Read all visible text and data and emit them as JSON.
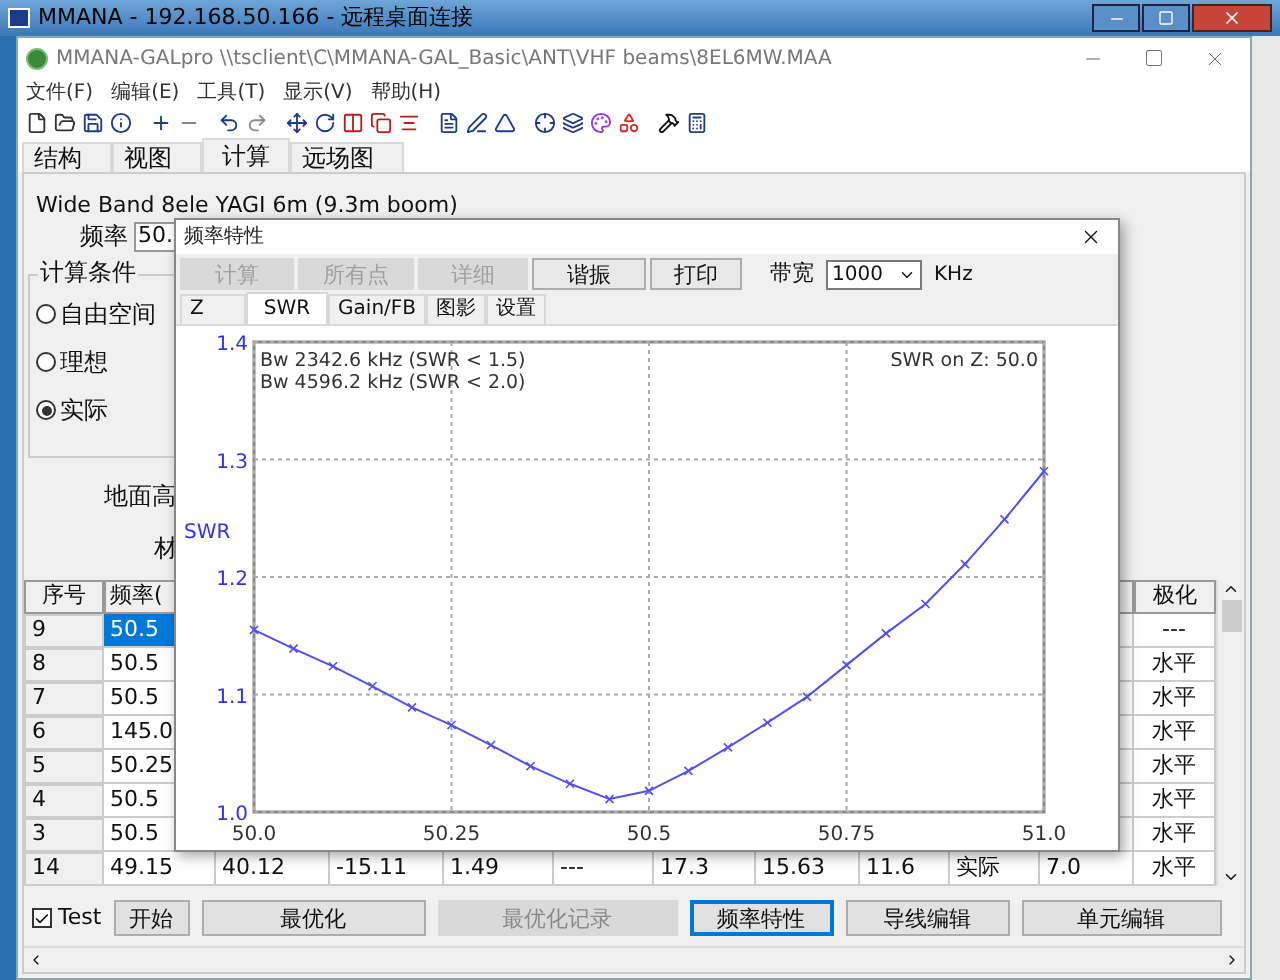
{
  "remote_window": {
    "title": "MMANA - 192.168.50.166 - 远程桌面连接"
  },
  "window": {
    "title": "MMANA-GALpro \\\\tsclient\\C\\MMANA-GAL_Basic\\ANT\\VHF beams\\8EL6MW.MAA"
  },
  "menu": [
    "文件(F)",
    "编辑(E)",
    "工具(T)",
    "显示(V)",
    "帮助(H)"
  ],
  "tabs": [
    {
      "label": "结构",
      "selected": false
    },
    {
      "label": "视图",
      "selected": false
    },
    {
      "label": "计算",
      "selected": true
    },
    {
      "label": "远场图",
      "selected": false
    }
  ],
  "antenna_name": "Wide Band 8ele YAGI 6m (9.3m boom)",
  "frequency": {
    "label": "频率",
    "value": "50."
  },
  "conditions": {
    "title": "计算条件",
    "options": [
      {
        "label": "自由空间",
        "selected": false
      },
      {
        "label": "理想",
        "selected": false
      },
      {
        "label": "实际",
        "selected": true
      }
    ]
  },
  "ground_height_label": "地面高",
  "material_label": "材",
  "table": {
    "columns": [
      "序号",
      "频率(",
      null,
      null,
      null,
      null,
      null,
      null,
      null,
      null,
      null,
      "极化"
    ],
    "rows": [
      {
        "selected": true,
        "cells": [
          "9",
          "50.5",
          null,
          null,
          null,
          null,
          null,
          null,
          null,
          null,
          null,
          "---"
        ]
      },
      {
        "selected": false,
        "cells": [
          "8",
          "50.5",
          null,
          null,
          null,
          null,
          null,
          null,
          null,
          null,
          null,
          "水平"
        ]
      },
      {
        "selected": false,
        "cells": [
          "7",
          "50.5",
          null,
          null,
          null,
          null,
          null,
          null,
          null,
          null,
          null,
          "水平"
        ]
      },
      {
        "selected": false,
        "cells": [
          "6",
          "145.0",
          null,
          null,
          null,
          null,
          null,
          null,
          null,
          null,
          null,
          "水平"
        ]
      },
      {
        "selected": false,
        "cells": [
          "5",
          "50.25",
          null,
          null,
          null,
          null,
          null,
          null,
          null,
          null,
          null,
          "水平"
        ]
      },
      {
        "selected": false,
        "cells": [
          "4",
          "50.5",
          null,
          null,
          null,
          null,
          null,
          null,
          null,
          null,
          null,
          "水平"
        ]
      },
      {
        "selected": false,
        "cells": [
          "3",
          "50.5",
          null,
          null,
          null,
          null,
          null,
          null,
          null,
          null,
          null,
          "水平"
        ]
      },
      {
        "selected": false,
        "cells": [
          "14",
          "49.15",
          "40.12",
          "-15.11",
          "1.49",
          "---",
          "17.3",
          "15.63",
          "11.6",
          "实际",
          "7.0",
          "水平"
        ]
      }
    ]
  },
  "test_checkbox": {
    "label": "Test",
    "checked": true
  },
  "buttons": [
    {
      "label": "开始",
      "disabled": false,
      "focused": false
    },
    {
      "label": "最优化",
      "disabled": false,
      "focused": false
    },
    {
      "label": "最优化记录",
      "disabled": true,
      "focused": false
    },
    {
      "label": "频率特性",
      "disabled": false,
      "focused": true
    },
    {
      "label": "导线编辑",
      "disabled": false,
      "focused": false
    },
    {
      "label": "单元编辑",
      "disabled": false,
      "focused": false
    }
  ],
  "dialog": {
    "title": "频率特性",
    "buttons": [
      {
        "label": "计算",
        "disabled": true
      },
      {
        "label": "所有点",
        "disabled": true
      },
      {
        "label": "详细",
        "disabled": true
      },
      {
        "label": "谐振",
        "disabled": false
      },
      {
        "label": "打印",
        "disabled": false
      }
    ],
    "bandwidth": {
      "label": "带宽",
      "value": "1000",
      "unit": "KHz"
    },
    "tabs": [
      {
        "label": "Z",
        "selected": false
      },
      {
        "label": "SWR",
        "selected": true
      },
      {
        "label": "Gain/FB",
        "selected": false
      },
      {
        "label": "图影",
        "selected": false
      },
      {
        "label": "设置",
        "selected": false
      }
    ],
    "chart_data": {
      "type": "line",
      "ylabel": "SWR",
      "x": [
        50.0,
        50.05,
        50.1,
        50.15,
        50.2,
        50.25,
        50.3,
        50.35,
        50.4,
        50.45,
        50.5,
        50.55,
        50.6,
        50.65,
        50.7,
        50.75,
        50.8,
        50.85,
        50.9,
        50.95,
        51.0
      ],
      "grid": true,
      "series": [
        {
          "color": "#5050f0",
          "marker": "x",
          "values": [
            1.155,
            1.139,
            1.124,
            1.107,
            1.089,
            1.074,
            1.057,
            1.039,
            1.024,
            1.011,
            1.018,
            1.035,
            1.055,
            1.076,
            1.098,
            1.125,
            1.152,
            1.177,
            1.211,
            1.249,
            1.29
          ]
        }
      ],
      "xlim": [
        50.0,
        51.0
      ],
      "ylim": [
        1.0,
        1.4
      ],
      "xticks": [
        {
          "value": 50.0,
          "label": "50.0"
        },
        {
          "value": 50.25,
          "label": "50.25"
        },
        {
          "value": 50.5,
          "label": "50.5"
        },
        {
          "value": 50.75,
          "label": "50.75"
        },
        {
          "value": 51.0,
          "label": "51.0"
        }
      ],
      "yticks": [
        {
          "value": 1.0,
          "label": "1.0"
        },
        {
          "value": 1.1,
          "label": "1.1"
        },
        {
          "value": 1.2,
          "label": "1.2"
        },
        {
          "value": 1.3,
          "label": "1.3"
        },
        {
          "value": 1.4,
          "label": "1.4"
        }
      ],
      "annotations": [
        "Bw 2342.6 kHz (SWR < 1.5)",
        "Bw 4596.2 kHz (SWR < 2.0)",
        "SWR on Z: 50.0"
      ]
    }
  }
}
